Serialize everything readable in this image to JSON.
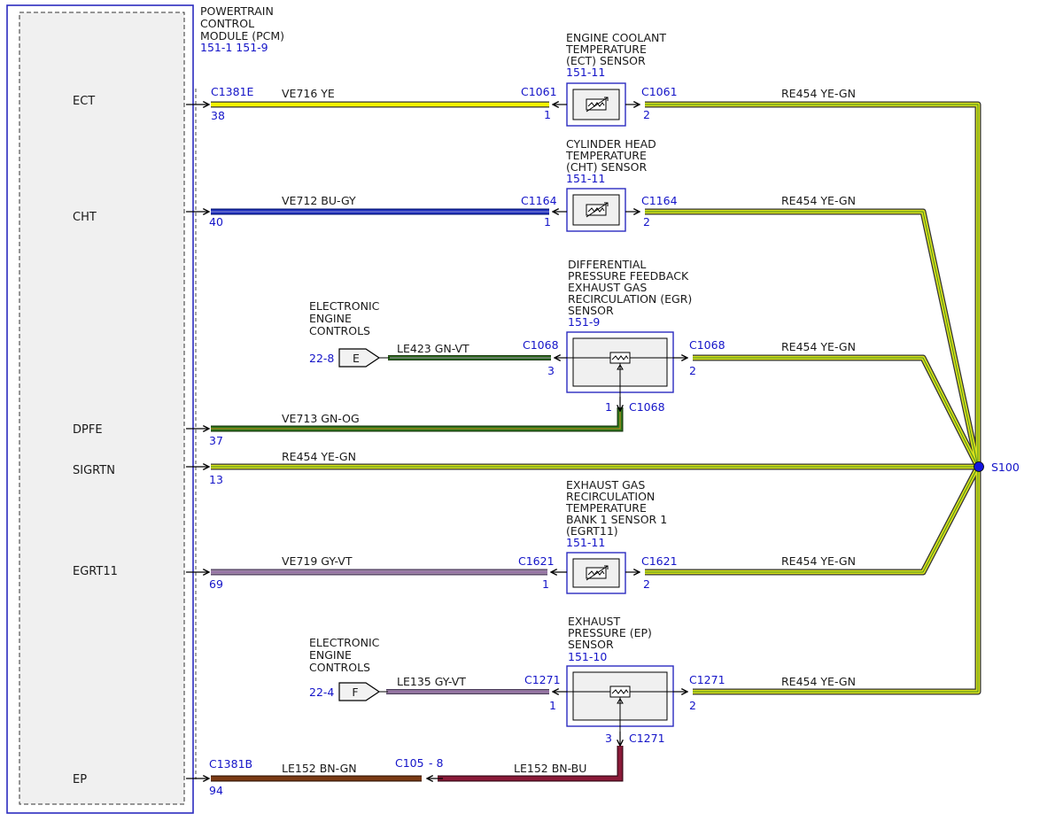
{
  "pcm": {
    "title": [
      "POWERTRAIN",
      "CONTROL",
      "MODULE (PCM)"
    ],
    "ref": "151-1 151-9",
    "signals": [
      "ECT",
      "CHT",
      "DPFE",
      "SIGRTN",
      "EGRT11",
      "EP"
    ]
  },
  "splice": {
    "label": "S100"
  },
  "sensors": [
    {
      "title": [
        "ENGINE COOLANT",
        "TEMPERATURE",
        "(ECT) SENSOR"
      ],
      "ref": "151-11"
    },
    {
      "title": [
        "CYLINDER HEAD",
        "TEMPERATURE",
        "(CHT) SENSOR"
      ],
      "ref": "151-11"
    },
    {
      "title": [
        "DIFFERENTIAL",
        "PRESSURE FEEDBACK",
        "EXHAUST GAS",
        "RECIRCULATION (EGR)",
        "SENSOR"
      ],
      "ref": "151-9"
    },
    {
      "title": [
        "EXHAUST GAS",
        "RECIRCULATION",
        "TEMPERATURE",
        "BANK 1 SENSOR 1",
        "(EGRT11)"
      ],
      "ref": "151-11"
    },
    {
      "title": [
        "EXHAUST",
        "PRESSURE (EP)",
        "SENSOR"
      ],
      "ref": "151-10"
    }
  ],
  "connectors": {
    "c1381e": "C1381E",
    "c1381b": "C1381B",
    "c1061": "C1061",
    "c1164": "C1164",
    "c1068": "C1068",
    "c1621": "C1621",
    "c1271": "C1271",
    "c105": "C105",
    "c105_pin": "- 8"
  },
  "pins": {
    "ect": "38",
    "cht": "40",
    "dpfe": "37",
    "sigrtn": "13",
    "egrt11": "69",
    "ep": "94",
    "one": "1",
    "two": "2",
    "three": "3"
  },
  "wires": {
    "ve716": "VE716  YE",
    "ve712": "VE712  BU-GY",
    "le423": "LE423  GN-VT",
    "ve713": "VE713  GN-OG",
    "re454": "RE454  YE-GN",
    "ve719": "VE719  GY-VT",
    "le135": "LE135  GY-VT",
    "le152a": "LE152  BN-GN",
    "le152b": "LE152  BN-BU"
  },
  "ext": {
    "title": [
      "ELECTRONIC",
      "ENGINE",
      "CONTROLS"
    ],
    "e_ref": "22-8",
    "e_letter": "E",
    "f_ref": "22-4",
    "f_letter": "F"
  },
  "colors": {
    "frame": "#2b2bc0",
    "ye": "#f2f200",
    "ye_gn": "#d6e01a",
    "bu_gy": "#1f2fbf",
    "gn": "#2f7a1a",
    "gy_vt": "#a08aa8",
    "bn": "#7a3a14",
    "bn_bu": "#8a1a38"
  }
}
